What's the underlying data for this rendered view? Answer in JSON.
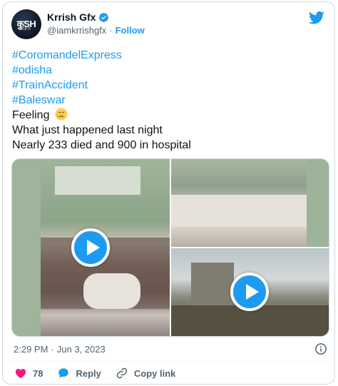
{
  "author": {
    "avatar_text": "कुSH",
    "avatar_sub": "GFX",
    "display_name": "Krrish Gfx",
    "handle": "@iamkrrishgfx",
    "separator": "·",
    "follow_label": "Follow"
  },
  "tweet": {
    "hashtags": [
      "#CoromandelExpress",
      "#odisha",
      "#TrainAccident",
      "#Baleswar"
    ],
    "line_feeling": "Feeling",
    "line_2": "What just happened last night",
    "line_3": "Nearly 233 died and 900 in hospital"
  },
  "meta": {
    "time": "2:29 PM",
    "separator": "·",
    "date": "Jun 3, 2023"
  },
  "actions": {
    "like_count": "78",
    "reply_label": "Reply",
    "copy_link_label": "Copy link"
  },
  "colors": {
    "accent": "#1d9bf0",
    "like": "#f91880",
    "muted": "#536471"
  }
}
